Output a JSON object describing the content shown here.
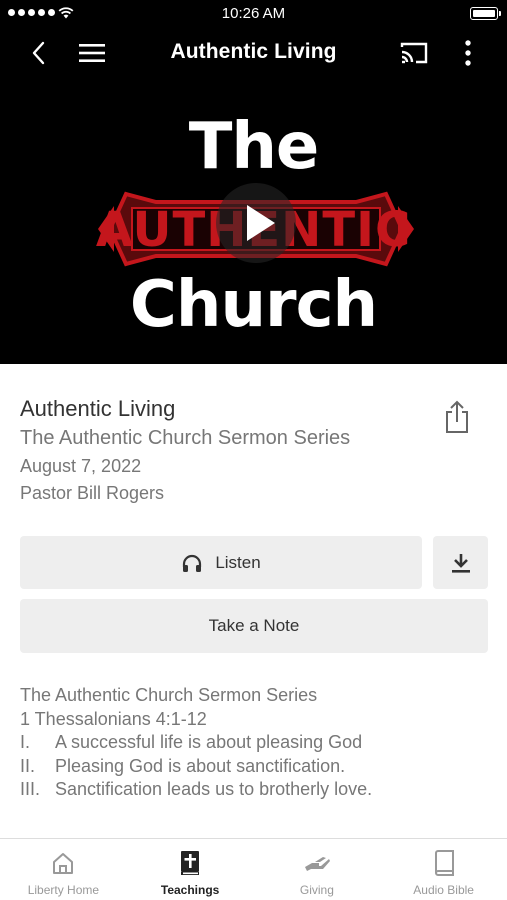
{
  "status_bar": {
    "time": "10:26 AM"
  },
  "header": {
    "title": "Authentic Living"
  },
  "artwork": {
    "line1": "The",
    "line2": "AUTHENTIC",
    "line3": "Church"
  },
  "sermon": {
    "title": "Authentic Living",
    "series": "The Authentic Church Sermon Series",
    "date": "August 7, 2022",
    "speaker": "Pastor Bill Rogers"
  },
  "actions": {
    "listen_label": "Listen",
    "note_label": "Take a Note"
  },
  "description": {
    "series": "The Authentic Church Sermon Series",
    "passage": "1 Thessalonians 4:1-12",
    "points": [
      {
        "num": "I.",
        "text": "A successful life is about pleasing God"
      },
      {
        "num": "II.",
        "text": "Pleasing God is about sanctification."
      },
      {
        "num": "III.",
        "text": "Sanctification leads us to brotherly love."
      }
    ]
  },
  "tabs": [
    {
      "label": "Liberty Home",
      "icon": "home-icon",
      "active": false
    },
    {
      "label": "Teachings",
      "icon": "bible-cross-icon",
      "active": true
    },
    {
      "label": "Giving",
      "icon": "giving-hand-icon",
      "active": false
    },
    {
      "label": "Audio Bible",
      "icon": "book-icon",
      "active": false
    }
  ],
  "colors": {
    "accent_red": "#c4161c",
    "header_bg": "#000000",
    "button_bg": "#eeeeee"
  }
}
